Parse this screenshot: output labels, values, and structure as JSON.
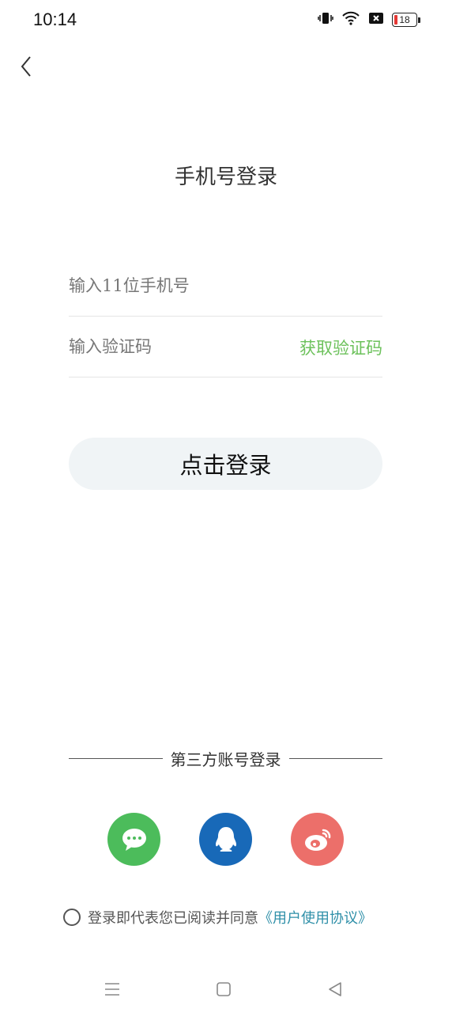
{
  "status_bar": {
    "time": "10:14",
    "battery": "18"
  },
  "title": "手机号登录",
  "phone_field": {
    "placeholder": "输入11位手机号"
  },
  "code_field": {
    "placeholder": "输入验证码",
    "get_code_label": "获取验证码"
  },
  "login_button": "点击登录",
  "third_party": {
    "label": "第三方账号登录",
    "providers": [
      "wechat-icon",
      "qq-icon",
      "weibo-icon"
    ]
  },
  "agreement": {
    "text": "登录即代表您已阅读并同意",
    "link": "《用户使用协议》"
  },
  "colors": {
    "accent_green": "#6cc15b",
    "link_blue": "#2e8fa8",
    "wechat": "#4cbc5b",
    "qq": "#1869b8",
    "weibo": "#ec6f6a"
  }
}
